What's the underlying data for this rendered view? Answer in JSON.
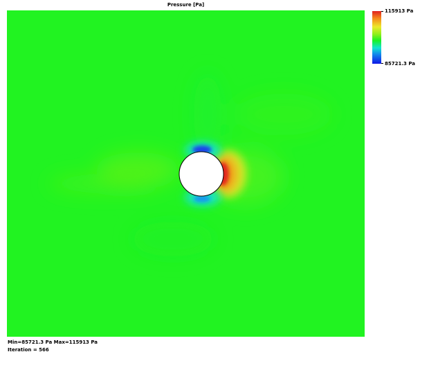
{
  "plot": {
    "title": "Pressure [Pa]"
  },
  "colorbar": {
    "max_label": "115913 Pa",
    "min_label": "85721.3 Pa",
    "colors": [
      "#e0201f",
      "#f58a1a",
      "#ece92a",
      "#8fef1c",
      "#19f225",
      "#12e4d0",
      "#1289ec",
      "#0f17e6"
    ]
  },
  "footer": {
    "minmax": "Min=85721.3 Pa   Max=115913 Pa",
    "iteration": "Iteration = 566"
  },
  "colors": {
    "background_field": "#21f321",
    "obstacle_fill": "#ffffff",
    "obstacle_stroke": "#000000"
  }
}
